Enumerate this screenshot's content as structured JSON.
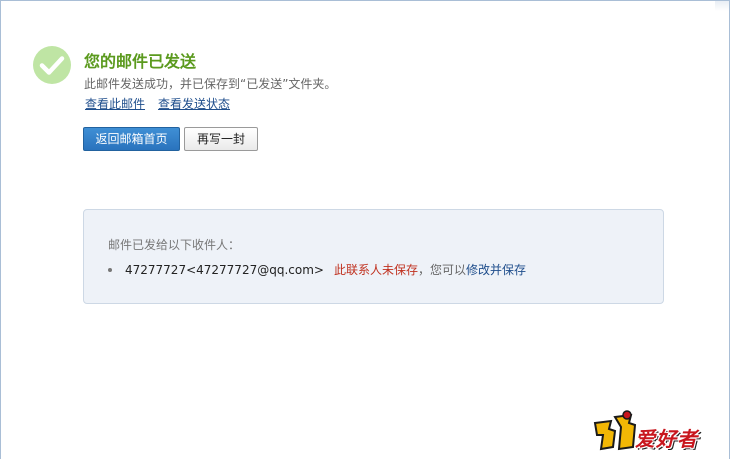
{
  "result": {
    "title": "您的邮件已发送",
    "description": "此邮件发送成功，并已保存到“已发送”文件夹。",
    "view_mail_link": "查看此邮件",
    "view_status_link": "查看发送状态"
  },
  "actions": {
    "back_to_inbox": "返回邮箱首页",
    "write_another": "再写一封"
  },
  "recipients": {
    "heading": "邮件已发给以下收件人：",
    "items": [
      {
        "address": "47277727<47277727@qq.com>",
        "status": "此联系人未保存",
        "hint": "，您可以",
        "action": "修改并保存"
      }
    ]
  },
  "watermark": {
    "text": "爱好者",
    "icon": "logo-mascot"
  },
  "colors": {
    "title_green": "#5b9a1e",
    "link_blue": "#1f4e8c",
    "primary_button": "#2a73bd",
    "warning_red": "#c0311f",
    "box_background": "#eef2f8"
  }
}
